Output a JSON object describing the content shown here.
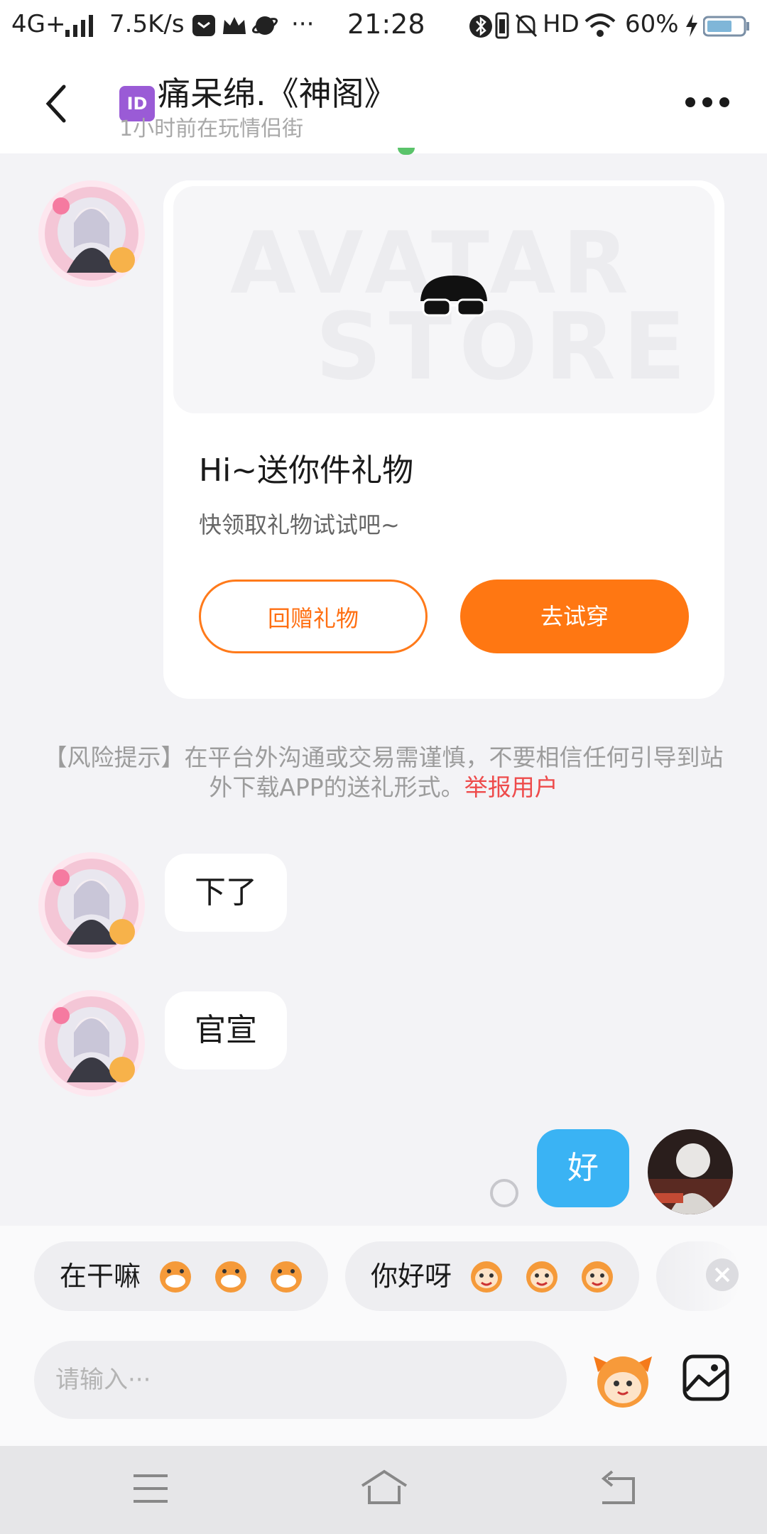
{
  "status_bar": {
    "network": "4G+",
    "speed": "7.5K/s",
    "time": "21:28",
    "hd": "HD",
    "battery": "60%"
  },
  "header": {
    "back_icon": "chevron-left-icon",
    "id_badge": "ID",
    "title": "痛呆绵.《神阁》",
    "subtitle": "1小时前在玩情侣街",
    "more_icon": "more-dots-icon"
  },
  "gift_card": {
    "banner_watermark_line1": "AVATAR",
    "banner_watermark_line2": "STORE",
    "title": "Hi~送你件礼物",
    "subtitle": "快领取礼物试试吧~",
    "return_gift_label": "回赠礼物",
    "try_on_label": "去试穿"
  },
  "risk_notice": {
    "text": "【风险提示】在平台外沟通或交易需谨慎，不要相信任何引导到站外下载APP的送礼形式。",
    "report_link": "举报用户"
  },
  "messages": [
    {
      "from": "other",
      "text": "下了"
    },
    {
      "from": "other",
      "text": "官宣"
    },
    {
      "from": "me",
      "text": "好"
    }
  ],
  "quick_replies": [
    {
      "label": "在干嘛"
    },
    {
      "label": "你好呀"
    }
  ],
  "input": {
    "placeholder": "请输入···"
  },
  "colors": {
    "accent_orange": "#ff7712",
    "bubble_blue": "#3ab3f4",
    "report_red": "#ee4b4b"
  }
}
